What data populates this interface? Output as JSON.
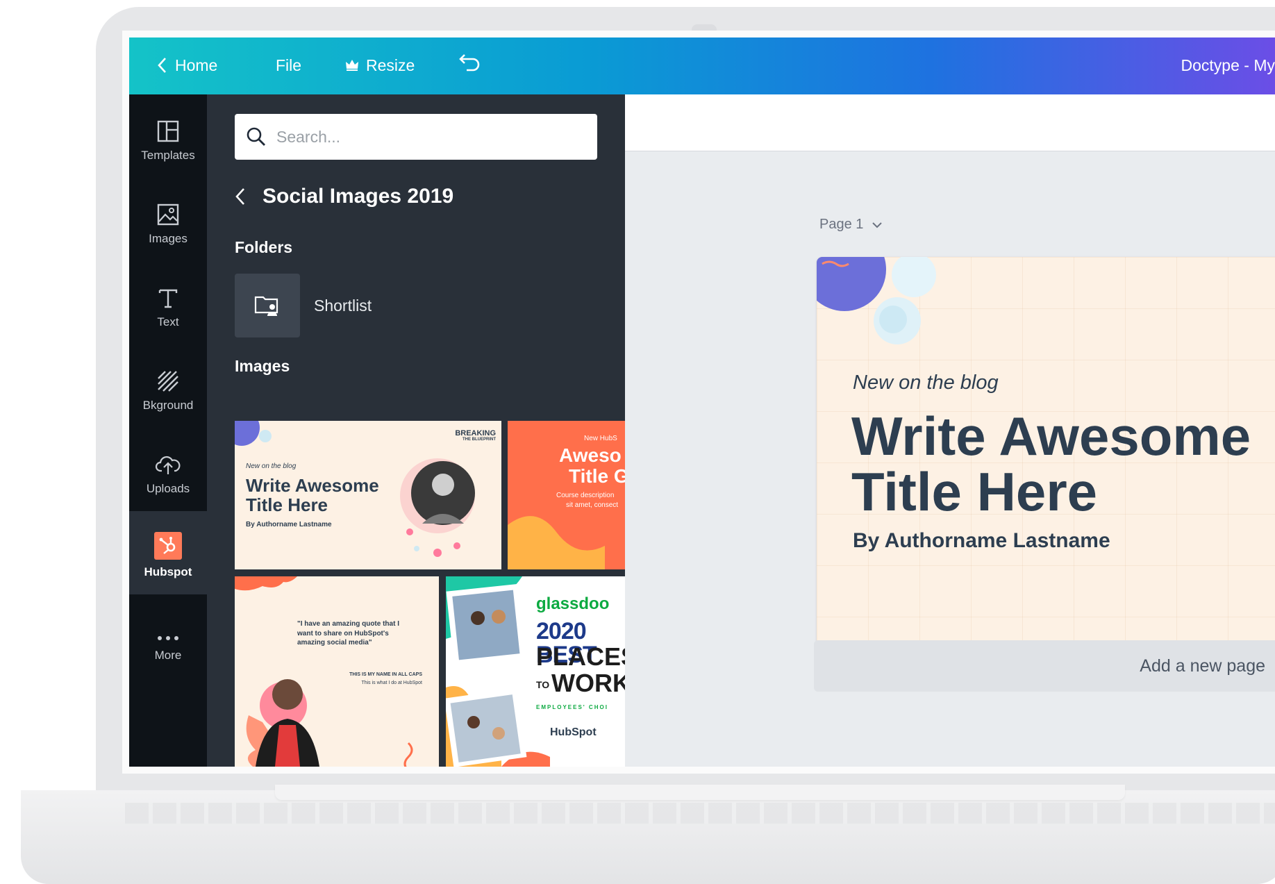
{
  "topbar": {
    "home_label": "Home",
    "file_label": "File",
    "resize_label": "Resize",
    "doc_title": "Doctype - My"
  },
  "rail": {
    "items": [
      {
        "label": "Templates",
        "icon": "templates-icon"
      },
      {
        "label": "Images",
        "icon": "image-icon"
      },
      {
        "label": "Text",
        "icon": "text-icon"
      },
      {
        "label": "Bkground",
        "icon": "background-icon"
      },
      {
        "label": "Uploads",
        "icon": "upload-cloud-icon"
      },
      {
        "label": "Hubspot",
        "icon": "hubspot-icon",
        "active": true
      },
      {
        "label": "More",
        "icon": "more-icon"
      }
    ]
  },
  "panel": {
    "search_placeholder": "Search...",
    "folder_title": "Social Images 2019",
    "folders_label": "Folders",
    "folders": [
      {
        "name": "Shortlist"
      }
    ],
    "images_label": "Images",
    "thumbnails": [
      {
        "kicker": "New on the blog",
        "title_line1": "Write Awesome",
        "title_line2": "Title Here",
        "author": "By Authorname Lastname",
        "badge": "BREAKING",
        "badge_sub": "THE BLUEPRINT"
      },
      {
        "kicker": "New HubS",
        "title_line1": "Aweso",
        "title_line2": "Title G",
        "body1": "Course description",
        "body2": "sit amet, consect"
      },
      {
        "quote": "\"I have an amazing quote that I want to share on HubSpot's amazing social media\"",
        "name": "THIS IS MY NAME IN ALL CAPS",
        "role": "This is what I do at HubSpot"
      },
      {
        "brand": "glassdoo",
        "line1": "2020 BEST",
        "line2": "PLACES",
        "line3": "WORK",
        "to": "TO",
        "choice": "EMPLOYEES' CHOI",
        "footer": "HubSpot"
      }
    ]
  },
  "editor": {
    "page_label": "Page 1",
    "design": {
      "kicker": "New on the blog",
      "title_line1": "Write Awesome",
      "title_line2": "Title Here",
      "author": "By Authorname Lastname"
    },
    "add_page_label": "Add a new page"
  },
  "colors": {
    "accent_teal": "#14c3c8",
    "accent_purple": "#6b4ee6",
    "hubspot_orange": "#ff7a59",
    "design_text": "#2d3e50",
    "design_bg": "#fdf1e4"
  }
}
